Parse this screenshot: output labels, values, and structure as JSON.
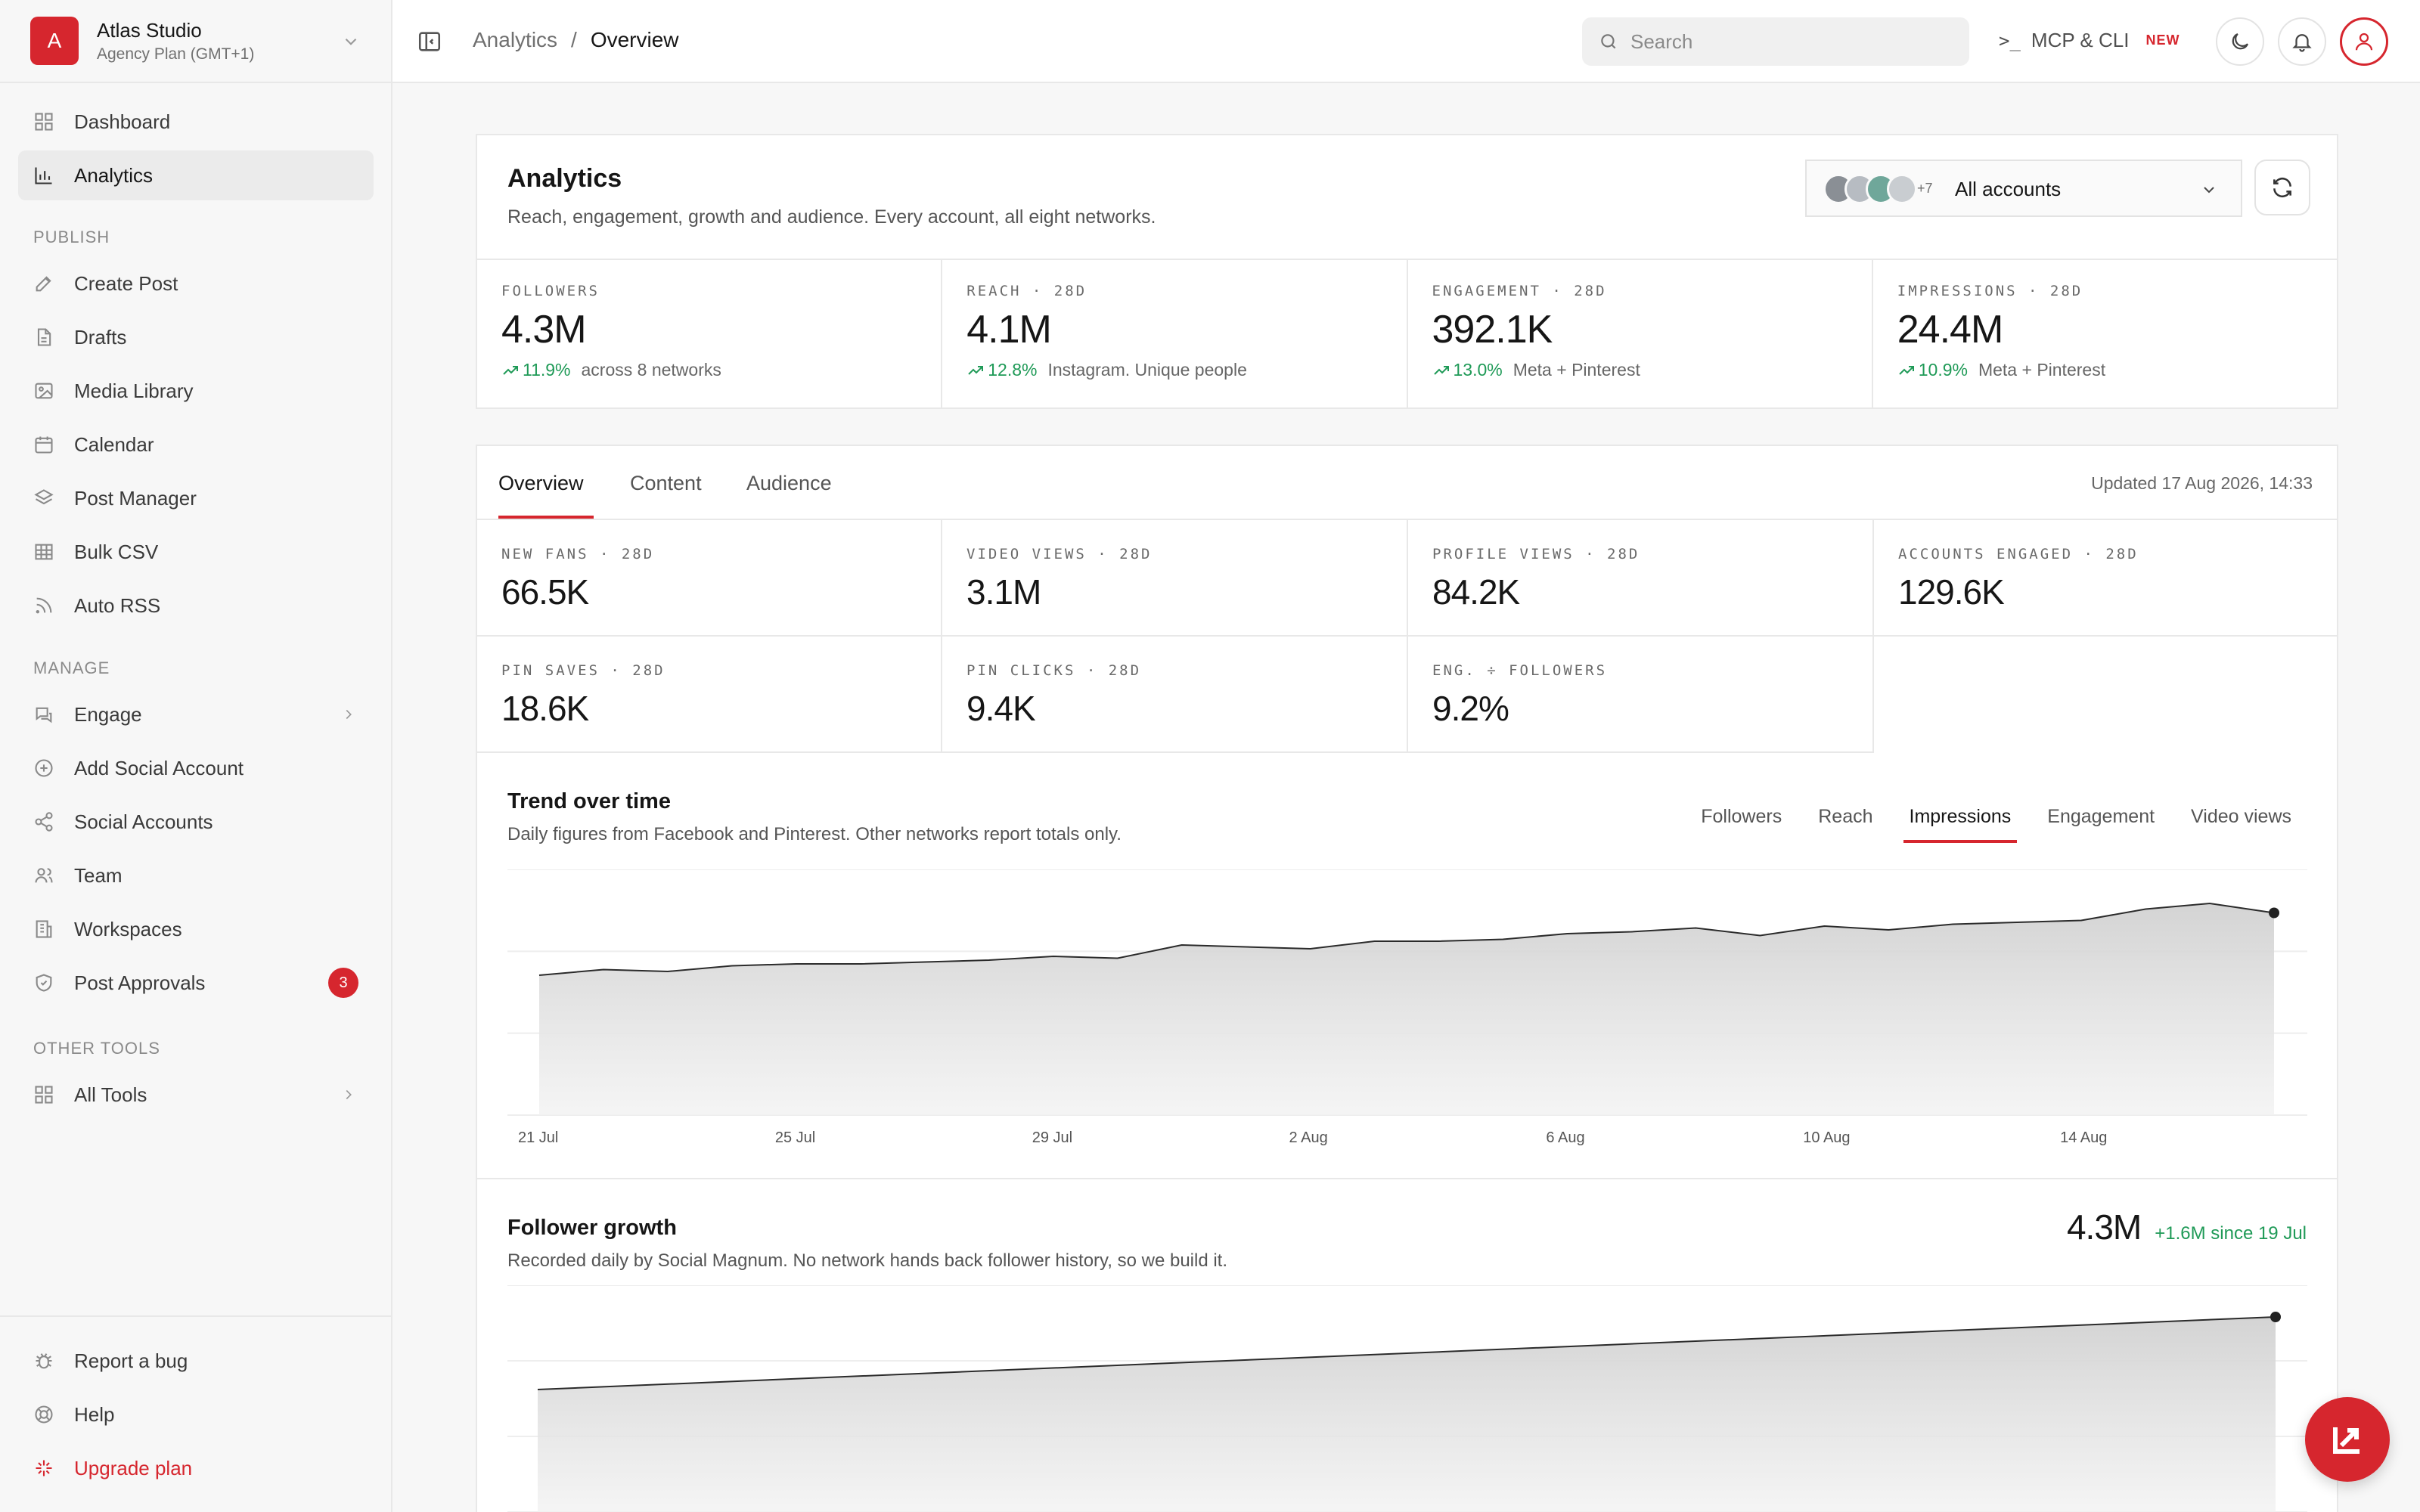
{
  "workspace": {
    "initial": "A",
    "name": "Atlas Studio",
    "plan": "Agency Plan (GMT+1)"
  },
  "nav": {
    "top": [
      {
        "label": "Dashboard",
        "icon": "grid-icon"
      },
      {
        "label": "Analytics",
        "icon": "bar-chart-icon",
        "active": true
      }
    ],
    "publish_title": "PUBLISH",
    "publish": [
      {
        "label": "Create Post",
        "icon": "edit-icon"
      },
      {
        "label": "Drafts",
        "icon": "file-icon"
      },
      {
        "label": "Media Library",
        "icon": "image-icon"
      },
      {
        "label": "Calendar",
        "icon": "calendar-icon"
      },
      {
        "label": "Post Manager",
        "icon": "layers-icon"
      },
      {
        "label": "Bulk CSV",
        "icon": "table-icon"
      },
      {
        "label": "Auto RSS",
        "icon": "rss-icon"
      }
    ],
    "manage_title": "MANAGE",
    "manage": [
      {
        "label": "Engage",
        "icon": "chat-icon"
      },
      {
        "label": "Add Social Account",
        "icon": "plus-circle-icon"
      },
      {
        "label": "Social Accounts",
        "icon": "share-icon"
      },
      {
        "label": "Team",
        "icon": "users-icon"
      },
      {
        "label": "Workspaces",
        "icon": "building-icon"
      },
      {
        "label": "Post Approvals",
        "icon": "shield-icon",
        "badge": "3"
      }
    ],
    "other_title": "OTHER TOOLS",
    "other": [
      {
        "label": "All Tools",
        "icon": "grid-icon"
      }
    ],
    "bottom": [
      {
        "label": "Report a bug",
        "icon": "bug-icon"
      },
      {
        "label": "Help",
        "icon": "lifebuoy-icon"
      },
      {
        "label": "Upgrade plan",
        "icon": "sparkle-icon"
      }
    ]
  },
  "topbar": {
    "breadcrumb": [
      "Analytics",
      "/",
      "Overview"
    ],
    "search_placeholder": "Search",
    "mcp_label": "MCP & CLI",
    "mcp_prompt": ">_",
    "mcp_badge": "NEW"
  },
  "header": {
    "title": "Analytics",
    "subtitle": "Reach, engagement, growth and audience. Every account, all eight networks.",
    "accounts_more": "+7",
    "accounts_label": "All accounts"
  },
  "kpis": [
    {
      "label": "FOLLOWERS",
      "value": "4.3M",
      "change": "11.9%",
      "note": "across 8 networks"
    },
    {
      "label": "REACH · 28D",
      "value": "4.1M",
      "change": "12.8%",
      "note": "Instagram. Unique people"
    },
    {
      "label": "ENGAGEMENT · 28D",
      "value": "392.1K",
      "change": "13.0%",
      "note": "Meta + Pinterest"
    },
    {
      "label": "IMPRESSIONS · 28D",
      "value": "24.4M",
      "change": "10.9%",
      "note": "Meta + Pinterest"
    }
  ],
  "tabs": [
    "Overview",
    "Content",
    "Audience"
  ],
  "updated": "Updated 17 Aug 2026, 14:33",
  "stats": [
    {
      "label": "NEW FANS · 28D",
      "value": "66.5K"
    },
    {
      "label": "VIDEO VIEWS · 28D",
      "value": "3.1M"
    },
    {
      "label": "PROFILE VIEWS · 28D",
      "value": "84.2K"
    },
    {
      "label": "ACCOUNTS ENGAGED · 28D",
      "value": "129.6K"
    },
    {
      "label": "PIN SAVES · 28D",
      "value": "18.6K"
    },
    {
      "label": "PIN CLICKS · 28D",
      "value": "9.4K"
    },
    {
      "label": "ENG. ÷ FOLLOWERS",
      "value": "9.2%"
    }
  ],
  "trend": {
    "title": "Trend over time",
    "subtitle": "Daily figures from Facebook and Pinterest. Other networks report totals only.",
    "metrics": [
      "Followers",
      "Reach",
      "Impressions",
      "Engagement",
      "Video views"
    ],
    "active_metric": "Impressions"
  },
  "growth": {
    "title": "Follower growth",
    "subtitle": "Recorded daily by Social Magnum. No network hands back follower history, so we build it.",
    "total": "4.3M",
    "delta": "+1.6M since 19 Jul"
  },
  "chart_data": [
    {
      "type": "area",
      "title": "Trend over time",
      "x": [
        "21 Jul",
        "22 Jul",
        "23 Jul",
        "24 Jul",
        "25 Jul",
        "26 Jul",
        "27 Jul",
        "28 Jul",
        "29 Jul",
        "30 Jul",
        "31 Jul",
        "1 Aug",
        "2 Aug",
        "3 Aug",
        "4 Aug",
        "5 Aug",
        "6 Aug",
        "7 Aug",
        "8 Aug",
        "9 Aug",
        "10 Aug",
        "11 Aug",
        "12 Aug",
        "13 Aug",
        "14 Aug",
        "15 Aug",
        "16 Aug",
        "17 Aug"
      ],
      "xticks": [
        "21 Jul",
        "25 Jul",
        "29 Jul",
        "2 Aug",
        "6 Aug",
        "10 Aug",
        "14 Aug"
      ],
      "values": [
        0.74,
        0.77,
        0.76,
        0.79,
        0.8,
        0.8,
        0.81,
        0.82,
        0.84,
        0.83,
        0.9,
        0.89,
        0.88,
        0.92,
        0.92,
        0.93,
        0.96,
        0.97,
        0.99,
        0.95,
        1.0,
        0.98,
        1.01,
        1.02,
        1.03,
        1.09,
        1.12,
        1.07
      ],
      "ylim": [
        0,
        1.3
      ],
      "grid": true,
      "color": "#2b2b2b"
    },
    {
      "type": "area",
      "title": "Follower growth",
      "x": [
        "19 Jul",
        "17 Aug"
      ],
      "values": [
        2.7,
        4.3
      ],
      "ylim": [
        0,
        5
      ],
      "grid": true,
      "color": "#2b2b2b"
    }
  ],
  "colors": {
    "accent": "#d6262e",
    "positive": "#1f9a57"
  }
}
